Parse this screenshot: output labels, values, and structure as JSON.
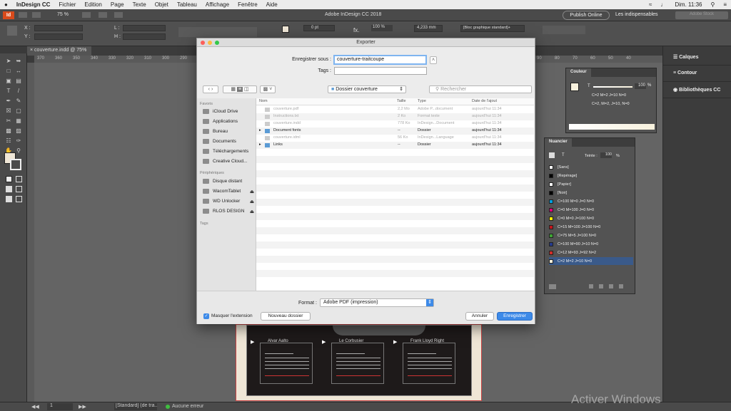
{
  "menubar": {
    "apple": "",
    "items": [
      "InDesign CC",
      "Fichier",
      "Edition",
      "Page",
      "Texte",
      "Objet",
      "Tableau",
      "Affichage",
      "Fenêtre",
      "Aide"
    ],
    "clock": "Dim. 11:36"
  },
  "apptitle": {
    "zoom": "75 %",
    "title": "Adobe InDesign CC 2018",
    "publish": "Publish Online",
    "workspace": "Les indispensables",
    "search_placeholder": "Adobe Stock"
  },
  "control": {
    "x_label": "X :",
    "y_label": "Y :",
    "w_label": "L :",
    "h_label": "H :",
    "stroke_weight": "0 pt",
    "percent": "100 %",
    "dimension": "4,233 mm",
    "style": "[Bloc graphique standard]+"
  },
  "document": {
    "tab": "couverture.indd @ 75%",
    "ruler_ticks": [
      "370",
      "360",
      "350",
      "340",
      "330",
      "320",
      "310",
      "300",
      "290",
      "280",
      "270",
      "260",
      "250",
      "240",
      "230",
      "220",
      "210",
      "200",
      "190",
      "180",
      "170",
      "160",
      "150",
      "140",
      "130",
      "120",
      "110",
      "100",
      "90",
      "80",
      "70",
      "60",
      "50",
      "40"
    ],
    "bios": [
      {
        "name": "Alvar Aalto"
      },
      {
        "name": "Le Corbusier"
      },
      {
        "name": "Frank Lloyd Right"
      }
    ]
  },
  "dialog": {
    "title": "Exporter",
    "save_as_label": "Enregistrer sous :",
    "save_as_value": "couverture-traitcoupe",
    "tags_label": "Tags :",
    "location": "Dossier couverture",
    "search_placeholder": "Rechercher",
    "sidebar": {
      "favorites_heading": "Favoris",
      "favorites": [
        "iCloud Drive",
        "Applications",
        "Bureau",
        "Documents",
        "Téléchargements",
        "Creative Cloud..."
      ],
      "devices_heading": "Périphériques",
      "devices": [
        "Disque distant",
        "WacomTablet",
        "WD Unlocker",
        "RLOS DESIGN"
      ],
      "tags_heading": "Tags"
    },
    "columns": [
      "Nom",
      "Taille",
      "Type",
      "Date de l'ajout"
    ],
    "files": [
      {
        "name": "couverture.pdf",
        "size": "2,2 Mo",
        "type": "Adobe P...document",
        "date": "aujourd'hui 11:34",
        "kind": "file",
        "dim": true
      },
      {
        "name": "Instructions.txt",
        "size": "2 Ko",
        "type": "Format texte",
        "date": "aujourd'hui 11:34",
        "kind": "file",
        "dim": true
      },
      {
        "name": "couverture.indd",
        "size": "778 Ko",
        "type": "InDesign...Document",
        "date": "aujourd'hui 11:34",
        "kind": "file",
        "dim": true
      },
      {
        "name": "Document fonts",
        "size": "--",
        "type": "Dossier",
        "date": "aujourd'hui 11:34",
        "kind": "folder",
        "dim": false
      },
      {
        "name": "couverture.idml",
        "size": "56 Ko",
        "type": "InDesign...Language",
        "date": "aujourd'hui 11:34",
        "kind": "file",
        "dim": true
      },
      {
        "name": "Links",
        "size": "--",
        "type": "Dossier",
        "date": "aujourd'hui 11:34",
        "kind": "folder",
        "dim": false
      }
    ],
    "format_label": "Format :",
    "format_value": "Adobe PDF (impression)",
    "hide_extension": "Masquer l'extension",
    "new_folder": "Nouveau dossier",
    "cancel": "Annuler",
    "save": "Enregistrer"
  },
  "panels": {
    "right": [
      "Calques",
      "Contour",
      "Bibliothèques CC"
    ],
    "color": {
      "title": "Couleur",
      "tint": "100",
      "percent": "%",
      "values": [
        "C=2 M=2 J=10 N=0",
        "C=2, M=2, J=10, N=0"
      ]
    },
    "swatches": {
      "title": "Nuancier",
      "tint_label": "Teinte :",
      "tint": "100",
      "percent": "%",
      "items": [
        {
          "name": "[Sans]",
          "color": "#ffffff"
        },
        {
          "name": "[Repérage]",
          "color": "#000000"
        },
        {
          "name": "[Papier]",
          "color": "#ffffff"
        },
        {
          "name": "[Noir]",
          "color": "#000000"
        },
        {
          "name": "C=100 M=0 J=0 N=0",
          "color": "#00a0e0"
        },
        {
          "name": "C=0 M=100 J=0 N=0",
          "color": "#e0007a"
        },
        {
          "name": "C=0 M=0 J=100 N=0",
          "color": "#fff000"
        },
        {
          "name": "C=15 M=100 J=100 N=0",
          "color": "#c4161c"
        },
        {
          "name": "C=75 M=5 J=100 N=0",
          "color": "#3fa535"
        },
        {
          "name": "C=100 M=90 J=10 N=0",
          "color": "#263b8c"
        },
        {
          "name": "C=12 M=93 J=92 N=2",
          "color": "#d22e2a"
        },
        {
          "name": "C=2 M=2 J=10 N=0",
          "color": "#f7f1dd"
        }
      ]
    }
  },
  "status": {
    "page": "1",
    "style": "[Standard] (de tra...",
    "errors": "Aucune erreur"
  },
  "watermark": "Activer Windows"
}
